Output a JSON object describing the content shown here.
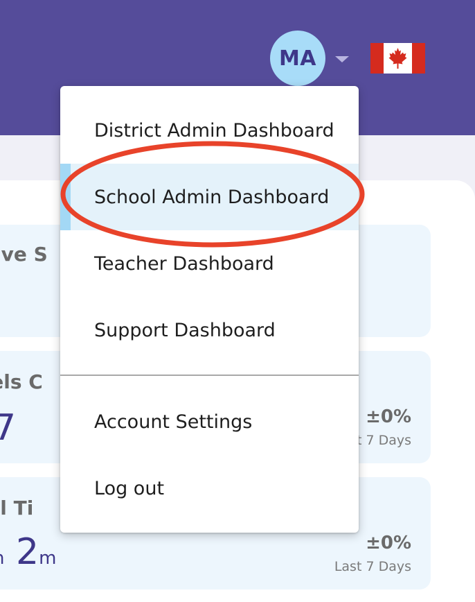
{
  "header": {
    "avatar_initials": "MA",
    "caret_icon": "caret-down-icon",
    "flag_icon": "canada-flag-icon",
    "brand_color": "#554c9a"
  },
  "cards": [
    {
      "title": "ctive S"
    },
    {
      "title": "vels C",
      "big_value": "7",
      "delta": "±0%",
      "period": "t 7 Days"
    },
    {
      "title": "tal Ti",
      "big_value_a_unit": "n",
      "big_value_b": "2",
      "big_value_b_unit": "m",
      "delta": "±0%",
      "period": "Last 7 Days"
    }
  ],
  "menu": {
    "items": [
      {
        "label": "District Admin Dashboard",
        "active": false
      },
      {
        "label": "School Admin Dashboard",
        "active": true
      },
      {
        "label": "Teacher Dashboard",
        "active": false
      },
      {
        "label": "Support Dashboard",
        "active": false
      },
      {
        "label": "Account Settings",
        "active": false
      },
      {
        "label": "Log out",
        "active": false
      }
    ]
  },
  "annotation": {
    "color": "#e8432a"
  }
}
